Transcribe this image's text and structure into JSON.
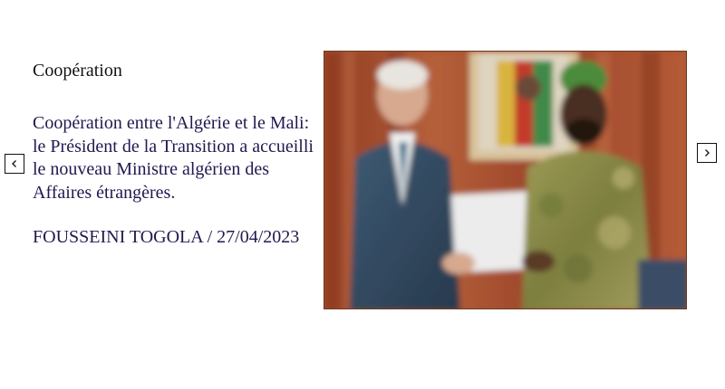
{
  "carousel": {
    "slide": {
      "category": "Coopération",
      "headline": "Coopération entre l'Algérie et le Mali: le Président de la Transition a accueilli le nouveau Ministre algérien des Affaires étrangères.",
      "byline": "FOUSSEINI TOGOLA / 27/04/2023"
    },
    "prev_icon": "chevron-left-icon",
    "next_icon": "chevron-right-icon"
  },
  "colors": {
    "headline": "#1f1a4f",
    "category": "#111111",
    "curtain": "#a8502e"
  }
}
